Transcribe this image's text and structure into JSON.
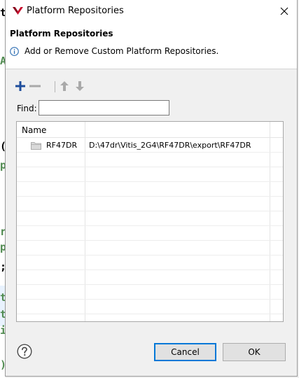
{
  "window": {
    "title": "Platform Repositories"
  },
  "header": {
    "title": "Platform Repositories",
    "message": "Add or Remove Custom Platform Repositories.",
    "info_icon": "info-icon"
  },
  "toolbar": {
    "add_icon": "plus-icon",
    "remove_icon": "minus-icon",
    "up_icon": "arrow-up-icon",
    "down_icon": "arrow-down-icon"
  },
  "find": {
    "label": "Find:",
    "value": ""
  },
  "table": {
    "column_header": "Name",
    "rows": [
      {
        "name": "RF47DR",
        "path": "D:\\47dr\\Vitis_2G4\\RF47DR\\export\\RF47DR"
      }
    ]
  },
  "buttons": {
    "cancel": "Cancel",
    "ok": "OK"
  },
  "background_editor": {
    "chars": [
      "t",
      "A",
      "(",
      "p",
      "r",
      "p",
      ";",
      "t",
      "t",
      "i",
      ")"
    ]
  },
  "colors": {
    "accent_red": "#c8102e",
    "plus_blue": "#1f4e9c",
    "info_blue": "#2f6fb3",
    "focus_blue": "#0078d7"
  }
}
